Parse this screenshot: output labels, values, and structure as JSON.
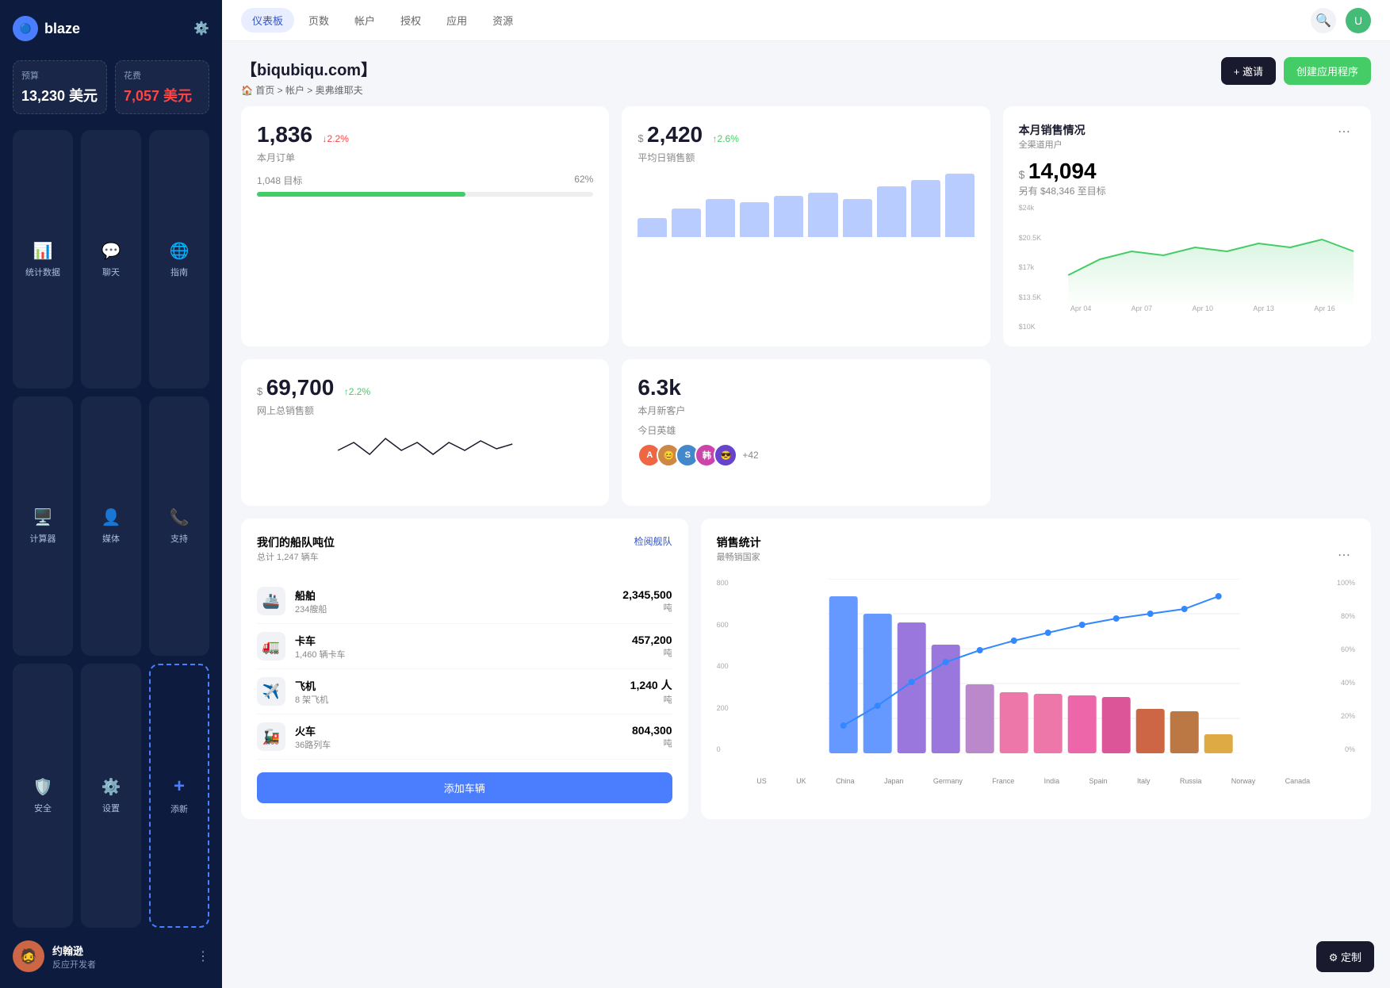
{
  "sidebar": {
    "logo_text": "blaze",
    "budget": {
      "label": "预算",
      "value": "13,230 美元"
    },
    "expense": {
      "label": "花费",
      "value": "7,057 美元"
    },
    "nav_items": [
      {
        "id": "stats",
        "label": "统计数据",
        "icon": "📊"
      },
      {
        "id": "chat",
        "label": "聊天",
        "icon": "💬"
      },
      {
        "id": "guide",
        "label": "指南",
        "icon": "🌐"
      },
      {
        "id": "calc",
        "label": "计算器",
        "icon": "🖥️"
      },
      {
        "id": "media",
        "label": "媒体",
        "icon": "👤"
      },
      {
        "id": "support",
        "label": "支持",
        "icon": "📞"
      },
      {
        "id": "security",
        "label": "安全",
        "icon": "🛡️"
      },
      {
        "id": "settings",
        "label": "设置",
        "icon": "⚙️"
      },
      {
        "id": "add",
        "label": "添新",
        "icon": "+"
      }
    ],
    "user": {
      "name": "约翰逊",
      "role": "反应开发者"
    }
  },
  "topnav": {
    "tabs": [
      {
        "id": "dashboard",
        "label": "仪表板",
        "active": true
      },
      {
        "id": "pages",
        "label": "页数"
      },
      {
        "id": "accounts",
        "label": "帐户"
      },
      {
        "id": "auth",
        "label": "授权"
      },
      {
        "id": "apps",
        "label": "应用"
      },
      {
        "id": "resources",
        "label": "资源"
      }
    ]
  },
  "page": {
    "title": "【biqubiqu.com】",
    "breadcrumb": "首页 > 帐户 > 奥弗维耶夫",
    "btn_invite": "+ 邀请",
    "btn_create": "创建应用程序"
  },
  "stats": {
    "orders": {
      "value": "1,836",
      "change": "↓2.2%",
      "change_type": "down",
      "label": "本月订单",
      "target_label": "1,048 目标",
      "target_pct": "62%",
      "progress": 62
    },
    "avg_sales": {
      "currency": "$",
      "value": "2,420",
      "change": "↑2.6%",
      "change_type": "up",
      "label": "平均日销售额",
      "bars": [
        30,
        45,
        60,
        55,
        65,
        70,
        60,
        80,
        90,
        100
      ]
    },
    "monthly_sales": {
      "title": "本月销售情况",
      "subtitle": "全渠道用户",
      "currency": "$",
      "value": "14,094",
      "sub_text": "另有 $48,346 至目标",
      "y_labels": [
        "$24k",
        "$20.5K",
        "$17k",
        "$13.5K",
        "$10K"
      ],
      "x_labels": [
        "Apr 04",
        "Apr 07",
        "Apr 10",
        "Apr 13",
        "Apr 16"
      ]
    }
  },
  "stats2": {
    "total_sales": {
      "currency": "$",
      "value": "69,700",
      "change": "↑2.2%",
      "change_type": "up",
      "label": "网上总销售额"
    },
    "new_customers": {
      "value": "6.3k",
      "label": "本月新客户",
      "heroes_label": "今日英雄",
      "heroes_count": "+42"
    }
  },
  "fleet": {
    "title": "我们的船队吨位",
    "subtitle": "总计 1,247 辆车",
    "link": "检阅舰队",
    "items": [
      {
        "icon": "🚢",
        "name": "船舶",
        "count": "234艘船",
        "value": "2,345,500",
        "unit": "吨"
      },
      {
        "icon": "🚛",
        "name": "卡车",
        "count": "1,460 辆卡车",
        "value": "457,200",
        "unit": "吨"
      },
      {
        "icon": "✈️",
        "name": "飞机",
        "count": "8 架飞机",
        "value": "1,240 人",
        "unit": "吨"
      },
      {
        "icon": "🚂",
        "name": "火车",
        "count": "36路列车",
        "value": "804,300",
        "unit": "吨"
      }
    ],
    "btn_add": "添加车辆"
  },
  "sales_stats": {
    "title": "销售统计",
    "subtitle": "最畅销国家",
    "countries": [
      "US",
      "UK",
      "China",
      "Japan",
      "Germany",
      "France",
      "India",
      "Spain",
      "Italy",
      "Russia",
      "Norway",
      "Canada"
    ],
    "values": [
      720,
      620,
      600,
      500,
      310,
      210,
      200,
      195,
      185,
      130,
      120,
      40
    ],
    "colors": [
      "#6699ff",
      "#6699ff",
      "#9977dd",
      "#9977dd",
      "#bb88cc",
      "#ee77aa",
      "#ee77aa",
      "#ee66aa",
      "#dd5599",
      "#cc6644",
      "#bb7744",
      "#ddaa44"
    ],
    "y_labels": [
      "800",
      "600",
      "400",
      "200",
      "0"
    ],
    "pct_labels": [
      "100%",
      "80%",
      "60%",
      "40%",
      "20%",
      "0%"
    ]
  },
  "customize": {
    "btn_label": "⚙ 定制"
  }
}
